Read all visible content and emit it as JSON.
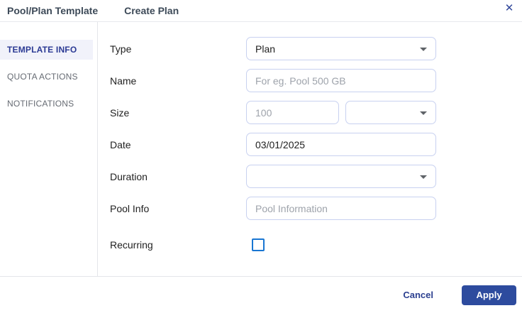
{
  "header": {
    "title": "Pool/Plan Template",
    "subtitle": "Create Plan",
    "close_glyph": "✕"
  },
  "sidebar": {
    "items": [
      {
        "label": "TEMPLATE INFO",
        "active": true
      },
      {
        "label": "QUOTA ACTIONS",
        "active": false
      },
      {
        "label": "NOTIFICATIONS",
        "active": false
      }
    ]
  },
  "form": {
    "type": {
      "label": "Type",
      "value": "Plan"
    },
    "name": {
      "label": "Name",
      "value": "",
      "placeholder": "For eg. Pool 500 GB"
    },
    "size": {
      "label": "Size",
      "value": "",
      "placeholder": "100",
      "unit_value": ""
    },
    "date": {
      "label": "Date",
      "value": "03/01/2025"
    },
    "duration": {
      "label": "Duration",
      "value": ""
    },
    "pool_info": {
      "label": "Pool Info",
      "value": "",
      "placeholder": "Pool Information"
    },
    "recurring": {
      "label": "Recurring",
      "checked": false
    }
  },
  "footer": {
    "cancel_label": "Cancel",
    "apply_label": "Apply"
  },
  "colors": {
    "accent": "#2d4b9e",
    "active_tab_bg": "#f1f2fa",
    "active_tab_text": "#2b3a94",
    "input_border": "#c8d1f0",
    "checkbox_border": "#1976d2",
    "placeholder": "#9ea3ab",
    "divider": "#e4e6ea"
  }
}
